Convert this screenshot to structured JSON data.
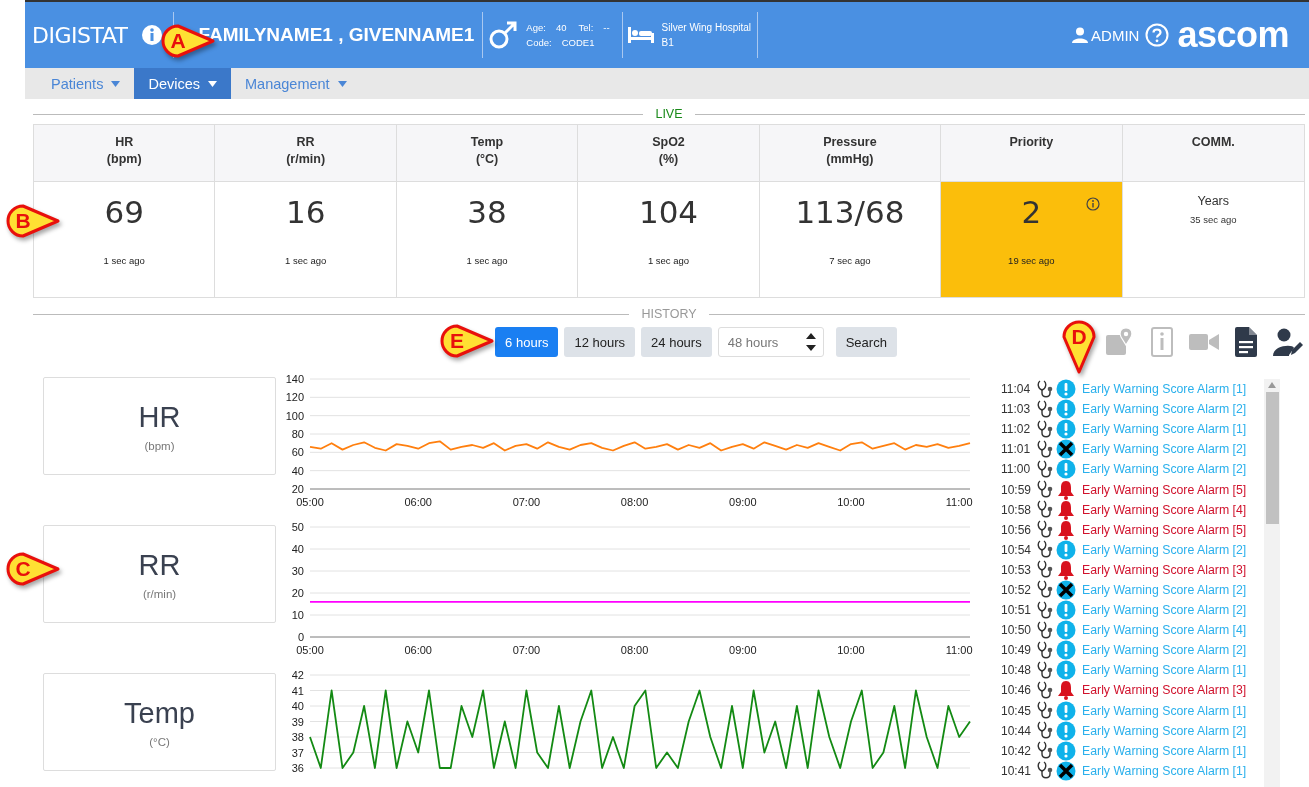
{
  "header": {
    "app_name": "DIGISTAT",
    "patient_name": "FAMILYNAME1 , GIVENNAME1",
    "age_label": "Age:",
    "age": "40",
    "tel_label": "Tel:",
    "tel": "--",
    "code_label": "Code:",
    "code": "CODE1",
    "hospital": "Silver Wing Hospital",
    "bed": "B1",
    "user": "ADMIN",
    "logo": "ascom"
  },
  "nav_tabs": [
    {
      "label": "Patients",
      "selected": false
    },
    {
      "label": "Devices",
      "selected": true
    },
    {
      "label": "Management",
      "selected": false
    }
  ],
  "live": {
    "title": "LIVE",
    "columns": [
      {
        "kind": "numeric",
        "label": "HR",
        "unit": "(bpm)",
        "value": "69",
        "age": "1 sec ago",
        "alert": false
      },
      {
        "kind": "numeric",
        "label": "RR",
        "unit": "(r/min)",
        "value": "16",
        "age": "1 sec ago",
        "alert": false
      },
      {
        "kind": "numeric",
        "label": "Temp",
        "unit": "(°C)",
        "value": "38",
        "age": "1 sec ago",
        "alert": false
      },
      {
        "kind": "numeric",
        "label": "SpO2",
        "unit": "(%)",
        "value": "104",
        "age": "1 sec ago",
        "alert": false
      },
      {
        "kind": "numeric",
        "label": "Pressure",
        "unit": "(mmHg)",
        "value": "113/68",
        "age": "7 sec ago",
        "alert": false
      },
      {
        "kind": "numeric",
        "label": "Priority",
        "value": "2",
        "age": "19 sec ago",
        "alert": true
      },
      {
        "kind": "text",
        "label": "COMM.",
        "value": "Years",
        "age": "35 sec ago",
        "alert": false
      }
    ]
  },
  "history": {
    "title": "HISTORY",
    "ranges": [
      {
        "label": "6 hours",
        "selected": true
      },
      {
        "label": "12 hours",
        "selected": false
      },
      {
        "label": "24 hours",
        "selected": false
      }
    ],
    "custom_range": {
      "placeholder": "48 hours"
    },
    "search_button": "Search",
    "tools": [
      {
        "kind": "map",
        "enabled": false
      },
      {
        "kind": "info",
        "enabled": false
      },
      {
        "kind": "video",
        "enabled": false
      },
      {
        "kind": "document",
        "enabled": true
      },
      {
        "kind": "user-edit",
        "enabled": true
      }
    ],
    "panels": [
      {
        "label": "HR",
        "unit": "(bpm)",
        "chart_data": {
          "type": "line",
          "x": [
            5,
            5.1,
            5.2,
            5.3,
            5.4,
            5.5,
            5.6,
            5.7,
            5.8,
            5.9,
            6,
            6.1,
            6.2,
            6.3,
            6.4,
            6.5,
            6.6,
            6.7,
            6.8,
            6.9,
            7,
            7.1,
            7.2,
            7.3,
            7.4,
            7.5,
            7.6,
            7.7,
            7.8,
            7.9,
            8,
            8.1,
            8.2,
            8.3,
            8.4,
            8.5,
            8.6,
            8.7,
            8.8,
            8.9,
            9,
            9.1,
            9.2,
            9.3,
            9.4,
            9.5,
            9.6,
            9.7,
            9.8,
            9.9,
            10,
            10.1,
            10.2,
            10.3,
            10.4,
            10.5,
            10.6,
            10.7,
            10.8,
            10.9,
            11,
            11.1
          ],
          "grid": true,
          "series": [
            {
              "color": "#ff7f0e",
              "values": [
                66,
                64,
                70,
                63,
                68,
                71,
                65,
                62,
                69,
                67,
                64,
                70,
                72,
                63,
                66,
                68,
                65,
                70,
                62,
                67,
                69,
                64,
                71,
                66,
                63,
                68,
                70,
                65,
                62,
                67,
                71,
                64,
                66,
                69,
                63,
                68,
                65,
                70,
                62,
                66,
                69,
                64,
                71,
                67,
                63,
                68,
                65,
                70,
                66,
                62,
                69,
                71,
                64,
                67,
                70,
                63,
                68,
                66,
                69,
                65,
                67,
                70
              ]
            }
          ],
          "xlim": [
            5,
            11.1
          ],
          "ylim": [
            20,
            140
          ],
          "yticks": [
            20,
            40,
            60,
            80,
            100,
            120,
            140
          ],
          "xticks": [
            {
              "value": 5,
              "label": "05:00"
            },
            {
              "value": 6,
              "label": "06:00"
            },
            {
              "value": 7,
              "label": "07:00"
            },
            {
              "value": 8,
              "label": "08:00"
            },
            {
              "value": 9,
              "label": "09:00"
            },
            {
              "value": 10,
              "label": "10:00"
            },
            {
              "value": 11,
              "label": "11:00"
            }
          ]
        }
      },
      {
        "label": "RR",
        "unit": "(r/min)",
        "chart_data": {
          "type": "line",
          "x": [
            5,
            11.1
          ],
          "grid": true,
          "series": [
            {
              "color": "#ff00ff",
              "values": [
                16,
                16
              ]
            }
          ],
          "xlim": [
            5,
            11.1
          ],
          "ylim": [
            0,
            50
          ],
          "yticks": [
            0,
            10,
            20,
            30,
            40,
            50
          ],
          "xticks": [
            {
              "value": 5,
              "label": "05:00"
            },
            {
              "value": 6,
              "label": "06:00"
            },
            {
              "value": 7,
              "label": "07:00"
            },
            {
              "value": 8,
              "label": "08:00"
            },
            {
              "value": 9,
              "label": "09:00"
            },
            {
              "value": 10,
              "label": "10:00"
            },
            {
              "value": 11,
              "label": "11:00"
            }
          ]
        }
      },
      {
        "label": "Temp",
        "unit": "(°C)",
        "chart_data": {
          "type": "line",
          "x": [
            5,
            5.1,
            5.2,
            5.3,
            5.4,
            5.5,
            5.6,
            5.7,
            5.8,
            5.9,
            6,
            6.1,
            6.2,
            6.3,
            6.4,
            6.5,
            6.6,
            6.7,
            6.8,
            6.9,
            7,
            7.1,
            7.2,
            7.3,
            7.4,
            7.5,
            7.6,
            7.7,
            7.8,
            7.9,
            8,
            8.1,
            8.2,
            8.3,
            8.4,
            8.5,
            8.6,
            8.7,
            8.8,
            8.9,
            9,
            9.1,
            9.2,
            9.3,
            9.4,
            9.5,
            9.6,
            9.7,
            9.8,
            9.9,
            10,
            10.1,
            10.2,
            10.3,
            10.4,
            10.5,
            10.6,
            10.7,
            10.8,
            10.9,
            11,
            11.1
          ],
          "grid": true,
          "series": [
            {
              "color": "#138a13",
              "values": [
                38,
                36,
                41,
                36,
                37,
                40,
                36,
                41,
                36,
                39,
                37,
                41,
                36,
                36,
                40,
                38,
                41,
                36,
                39,
                36,
                41,
                37,
                36,
                40,
                36,
                39,
                41,
                36,
                38,
                36,
                40,
                41,
                36,
                37,
                36,
                39,
                41,
                38,
                36,
                40,
                36,
                41,
                37,
                39,
                36,
                40,
                36,
                41,
                38,
                36,
                39,
                41,
                36,
                37,
                40,
                36,
                41,
                38,
                36,
                40,
                38,
                39
              ]
            }
          ],
          "xlim": [
            5,
            11.1
          ],
          "ylim": [
            36,
            42
          ],
          "yticks": [
            36,
            37,
            38,
            39,
            40,
            41,
            42
          ]
        }
      }
    ]
  },
  "events": [
    {
      "time": "11:04",
      "kind": "info",
      "text": "Early Warning Score Alarm [1]"
    },
    {
      "time": "11:03",
      "kind": "info",
      "text": "Early Warning Score Alarm [2]"
    },
    {
      "time": "11:02",
      "kind": "info",
      "text": "Early Warning Score Alarm [1]"
    },
    {
      "time": "11:01",
      "kind": "cancelled",
      "text": "Early Warning Score Alarm [2]"
    },
    {
      "time": "11:00",
      "kind": "info",
      "text": "Early Warning Score Alarm [2]"
    },
    {
      "time": "10:59",
      "kind": "alarm",
      "text": "Early Warning Score Alarm [5]"
    },
    {
      "time": "10:58",
      "kind": "alarm",
      "text": "Early Warning Score Alarm [4]"
    },
    {
      "time": "10:56",
      "kind": "alarm",
      "text": "Early Warning Score Alarm [5]"
    },
    {
      "time": "10:54",
      "kind": "info",
      "text": "Early Warning Score Alarm [2]"
    },
    {
      "time": "10:53",
      "kind": "alarm",
      "text": "Early Warning Score Alarm [3]"
    },
    {
      "time": "10:52",
      "kind": "cancelled",
      "text": "Early Warning Score Alarm [2]"
    },
    {
      "time": "10:51",
      "kind": "info",
      "text": "Early Warning Score Alarm [2]"
    },
    {
      "time": "10:50",
      "kind": "info",
      "text": "Early Warning Score Alarm [4]"
    },
    {
      "time": "10:49",
      "kind": "info",
      "text": "Early Warning Score Alarm [2]"
    },
    {
      "time": "10:48",
      "kind": "info",
      "text": "Early Warning Score Alarm [1]"
    },
    {
      "time": "10:46",
      "kind": "alarm",
      "text": "Early Warning Score Alarm [3]"
    },
    {
      "time": "10:45",
      "kind": "info",
      "text": "Early Warning Score Alarm [1]"
    },
    {
      "time": "10:44",
      "kind": "info",
      "text": "Early Warning Score Alarm [2]"
    },
    {
      "time": "10:42",
      "kind": "info",
      "text": "Early Warning Score Alarm [1]"
    },
    {
      "time": "10:41",
      "kind": "cancelled",
      "text": "Early Warning Score Alarm [1]"
    }
  ],
  "callouts": [
    {
      "letter": "A"
    },
    {
      "letter": "B"
    },
    {
      "letter": "C"
    },
    {
      "letter": "D"
    },
    {
      "letter": "E"
    }
  ]
}
